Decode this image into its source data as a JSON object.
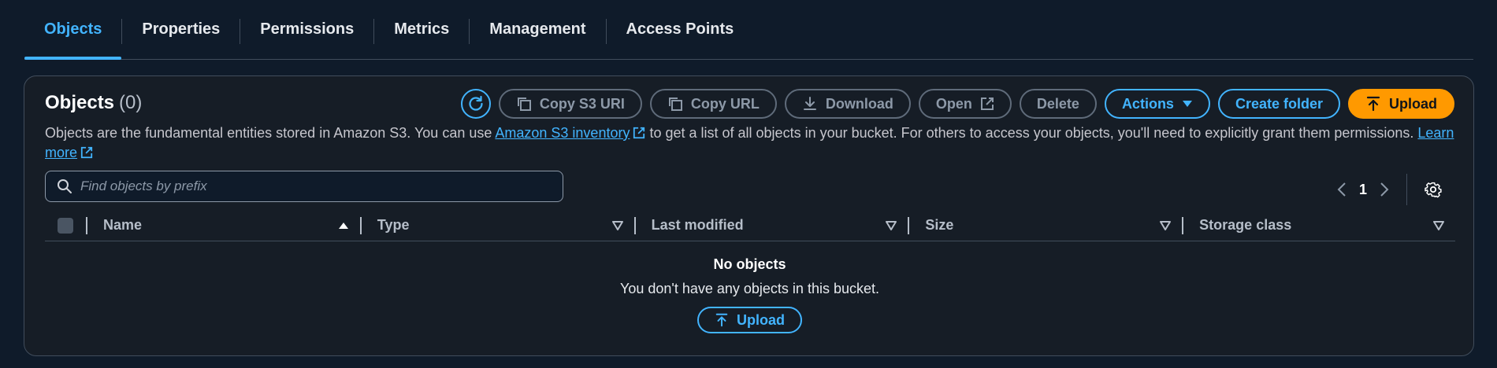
{
  "tabs": [
    {
      "label": "Objects",
      "active": true
    },
    {
      "label": "Properties",
      "active": false
    },
    {
      "label": "Permissions",
      "active": false
    },
    {
      "label": "Metrics",
      "active": false
    },
    {
      "label": "Management",
      "active": false
    },
    {
      "label": "Access Points",
      "active": false
    }
  ],
  "panel": {
    "title": "Objects",
    "count": "(0)",
    "toolbar": {
      "refresh_icon": "refresh-icon",
      "copy_s3_uri": "Copy S3 URI",
      "copy_url": "Copy URL",
      "download": "Download",
      "open": "Open",
      "delete": "Delete",
      "actions": "Actions",
      "create_folder": "Create folder",
      "upload": "Upload"
    },
    "description": {
      "part1": "Objects are the fundamental entities stored in Amazon S3. You can use ",
      "link1": "Amazon S3 inventory",
      "part2": " to get a list of all objects in your bucket. For others to access your objects, you'll need to explicitly grant them permissions. ",
      "link2": "Learn more"
    },
    "search": {
      "placeholder": "Find objects by prefix",
      "value": ""
    },
    "pagination": {
      "page": "1"
    },
    "columns": [
      "Name",
      "Type",
      "Last modified",
      "Size",
      "Storage class"
    ],
    "empty": {
      "title": "No objects",
      "text": "You don't have any objects in this bucket.",
      "upload": "Upload"
    }
  },
  "colors": {
    "accent": "#42b4ff",
    "primary_button": "#ff9900",
    "background": "#0f1b2a",
    "panel": "#161d26"
  }
}
